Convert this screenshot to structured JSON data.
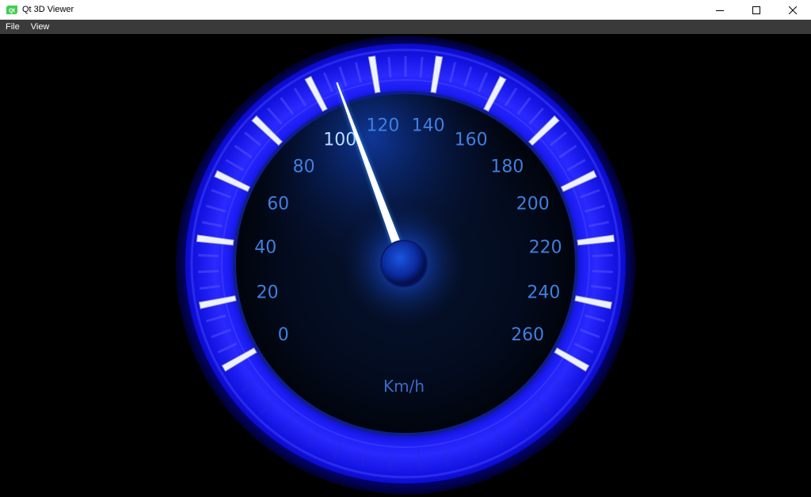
{
  "window": {
    "title": "Qt 3D Viewer",
    "icon": "qt-logo-icon",
    "controls": [
      "minimize-icon",
      "maximize-icon",
      "close-icon"
    ]
  },
  "menubar": {
    "items": [
      {
        "label": "File"
      },
      {
        "label": "View"
      }
    ]
  },
  "gauge": {
    "unit": "Km/h",
    "scale_min": 0,
    "scale_max": 260,
    "major_step": 20,
    "labels": [
      "0",
      "20",
      "40",
      "60",
      "80",
      "100",
      "120",
      "140",
      "160",
      "180",
      "200",
      "220",
      "240",
      "260"
    ],
    "current_value": 108,
    "colors": {
      "accent": "#1414ff",
      "label": "#3f7fe0",
      "label_highlight": "#b8ddff",
      "needle": "#ffffff",
      "face": "#020816"
    }
  }
}
